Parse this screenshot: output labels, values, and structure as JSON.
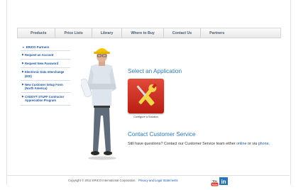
{
  "nav": {
    "items": [
      "Products",
      "Price Lists",
      "Library",
      "Where to Buy",
      "Contact Us",
      "Partners"
    ]
  },
  "sidebar": {
    "heading": "ERICO Partners",
    "items": [
      "Request an Account",
      "Request New Password",
      "Electronic Data Interchange (EDI)",
      "New Customer Setup Form (North America)",
      "CADDY® STUFF Contractor Appreciation Program"
    ]
  },
  "main": {
    "app_title": "Select an Application",
    "tile_caption": "Configure a Solution",
    "cs_title": "Contact Customer Service",
    "cs_text_before": "Still have questions? Contact our Customer Service team either ",
    "cs_link_online": "online",
    "cs_text_mid": " or via ",
    "cs_link_phone": "phone",
    "cs_text_end": "."
  },
  "footer": {
    "copyright": "Copyright © 2012 ERICO International Corporation.",
    "privacy_link": "Privacy and Legal Statements",
    "youtube_label": "You Tube",
    "linkedin_label": "in"
  },
  "colors": {
    "accent_blue": "#2b78b8",
    "link_blue": "#1e57a6",
    "tile_red": "#d33a2c"
  }
}
